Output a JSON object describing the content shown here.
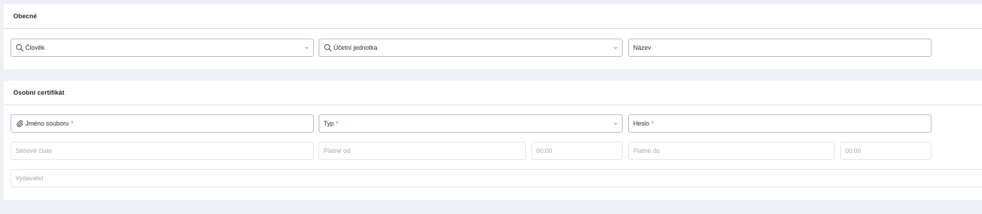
{
  "general": {
    "title": "Obecné",
    "person": {
      "placeholder": "Člověk",
      "icon": "search-icon"
    },
    "accounting_unit": {
      "placeholder": "Účetní jednotka",
      "icon": "search-icon"
    },
    "name": {
      "placeholder": "Název"
    }
  },
  "certificate": {
    "title": "Osobní certifikát",
    "file_name": {
      "placeholder": "Jméno souboru",
      "required_mark": "*",
      "icon": "paperclip-icon"
    },
    "type": {
      "placeholder": "Typ",
      "required_mark": "*"
    },
    "password": {
      "placeholder": "Heslo",
      "required_mark": "*"
    },
    "serial_number": {
      "placeholder": "Sériové číslo"
    },
    "valid_from": {
      "placeholder": "Platné od",
      "time": "00:00"
    },
    "valid_to": {
      "placeholder": "Platné do",
      "time": "00:00"
    },
    "issuer": {
      "placeholder": "Vydavatel"
    }
  },
  "colors": {
    "page_bg": "#eff0f5",
    "card_bg": "#ffffff",
    "required": "#e2505a",
    "field_border": "#b4b8c2"
  }
}
